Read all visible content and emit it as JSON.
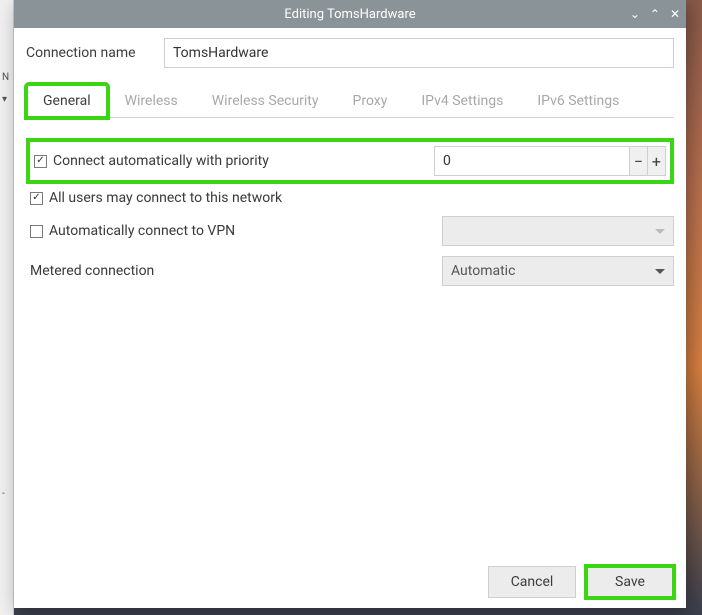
{
  "window": {
    "title": "Editing TomsHardware"
  },
  "connection": {
    "name_label": "Connection name",
    "name_value": "TomsHardware"
  },
  "tabs": [
    {
      "label": "General",
      "active": true
    },
    {
      "label": "Wireless",
      "active": false
    },
    {
      "label": "Wireless Security",
      "active": false
    },
    {
      "label": "Proxy",
      "active": false
    },
    {
      "label": "IPv4 Settings",
      "active": false
    },
    {
      "label": "IPv6 Settings",
      "active": false
    }
  ],
  "general": {
    "auto_connect": {
      "label": "Connect automatically with priority",
      "checked": true,
      "priority": "0"
    },
    "all_users": {
      "label": "All users may connect to this network",
      "checked": true
    },
    "auto_vpn": {
      "label": "Automatically connect to VPN",
      "checked": false,
      "dropdown_value": ""
    },
    "metered": {
      "label": "Metered connection",
      "dropdown_value": "Automatic"
    }
  },
  "buttons": {
    "cancel": "Cancel",
    "save": "Save"
  },
  "glyphs": {
    "minus": "−",
    "plus": "+"
  }
}
